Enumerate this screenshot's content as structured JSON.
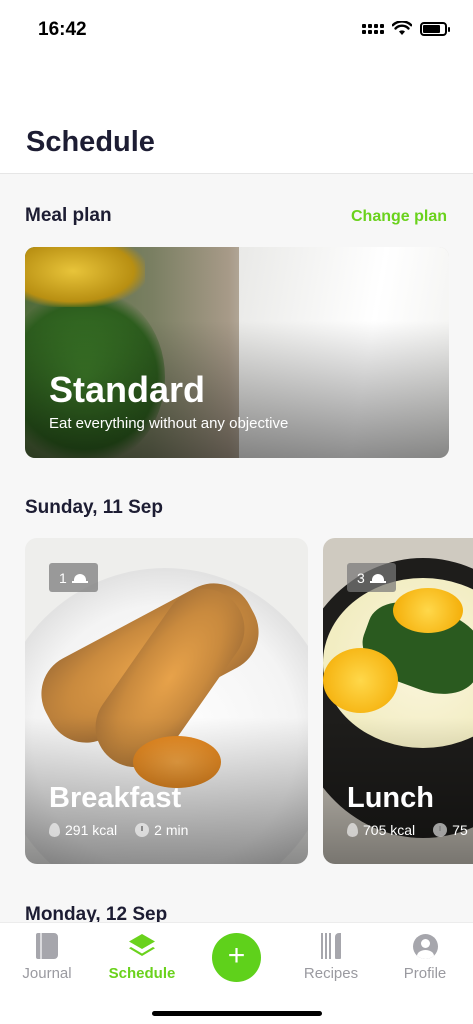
{
  "status_bar": {
    "time": "16:42",
    "signal_icon": "signal-icon",
    "wifi_icon": "wifi-icon",
    "battery_icon": "battery-icon",
    "battery_level": 0.8
  },
  "header": {
    "title": "Schedule"
  },
  "meal_plan": {
    "section_title": "Meal plan",
    "change_label": "Change plan",
    "plan_name": "Standard",
    "plan_description": "Eat everything without any objective"
  },
  "days": [
    {
      "label": "Sunday, 11 Sep",
      "meals": [
        {
          "name": "Breakfast",
          "servings": "1",
          "kcal": "291 kcal",
          "time": "2 min"
        },
        {
          "name": "Lunch",
          "servings": "3",
          "kcal": "705 kcal",
          "time": "75"
        }
      ]
    },
    {
      "label": "Monday, 12 Sep"
    }
  ],
  "tabbar": {
    "tabs": [
      {
        "label": "Journal",
        "icon": "journal-book-icon"
      },
      {
        "label": "Schedule",
        "icon": "layers-icon"
      },
      {
        "label": "Recipes",
        "icon": "fork-knife-icon"
      },
      {
        "label": "Profile",
        "icon": "profile-icon"
      }
    ],
    "add_label": "+",
    "active_tab": "Schedule"
  },
  "colors": {
    "accent": "#6ad21c",
    "title": "#1d1d33",
    "inactive": "#9a9aa0"
  }
}
